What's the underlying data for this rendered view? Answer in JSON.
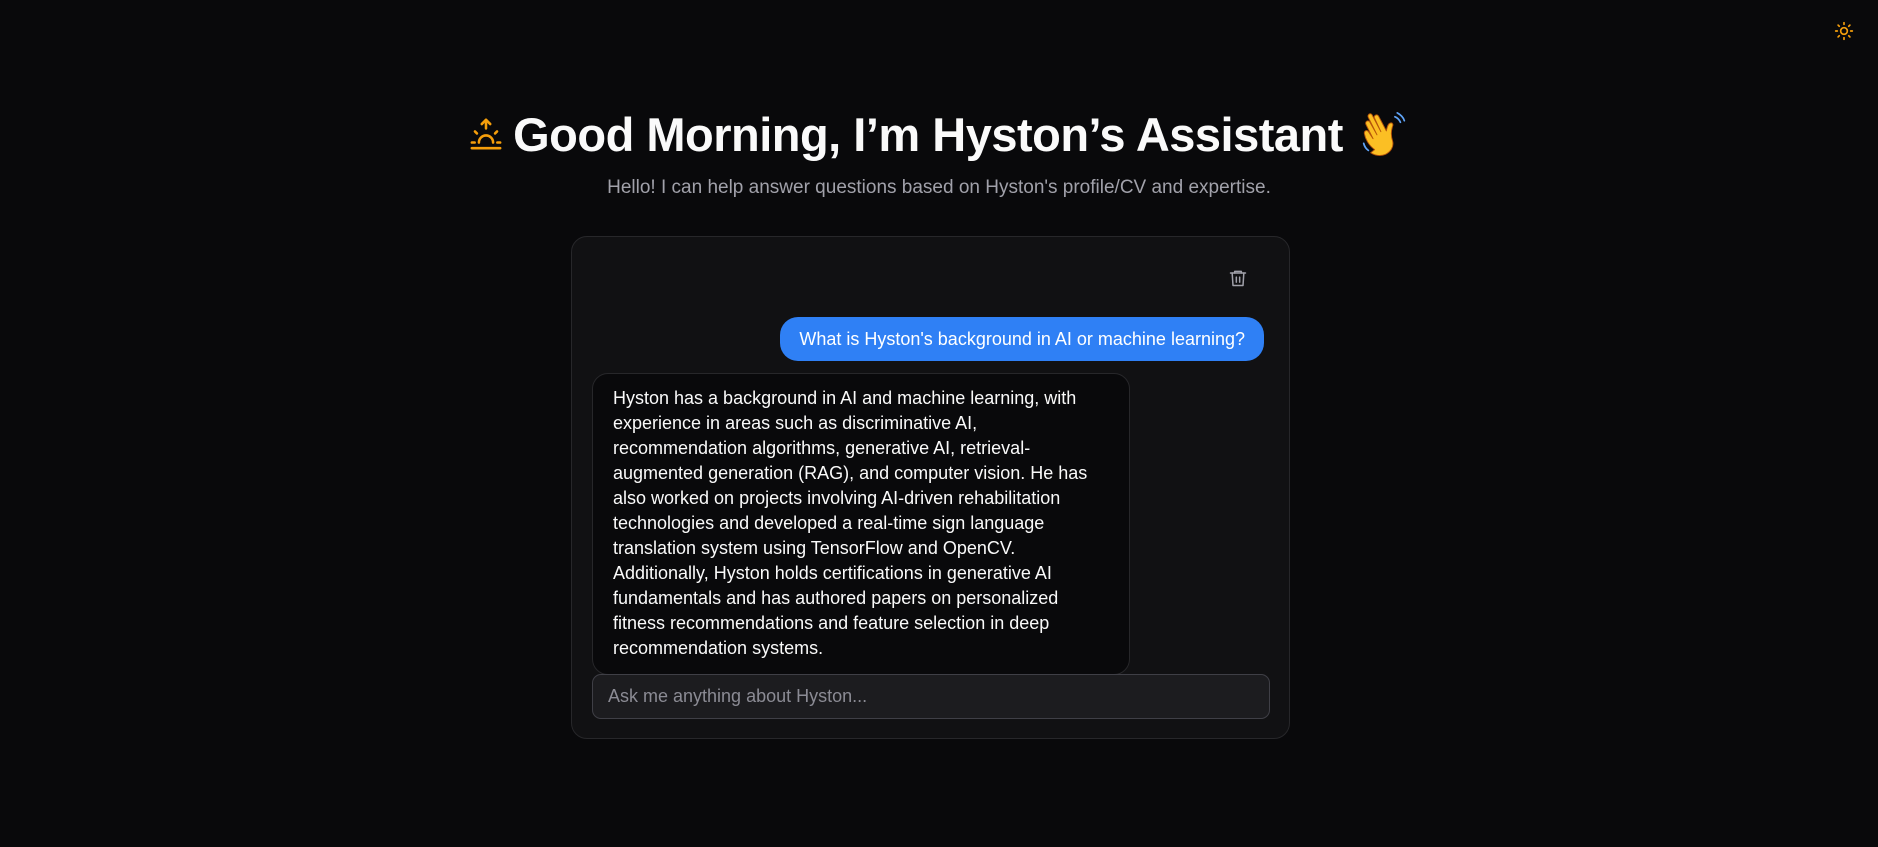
{
  "header": {
    "theme_toggle_icon": "sun-icon",
    "theme_icon_color": "#f59e0b"
  },
  "hero": {
    "greeting_icon": "sunrise-icon",
    "title": "Good Morning, I’m Hyston’s Assistant",
    "title_emoji_icon": "waving-hand-icon",
    "subtitle": "Hello! I can help answer questions based on Hyston's profile/CV and expertise."
  },
  "chat": {
    "clear_icon": "trash-icon",
    "messages": [
      {
        "role": "user",
        "text": "What is Hyston's background in AI or machine learning?"
      },
      {
        "role": "assistant",
        "text": "Hyston has a background in AI and machine learning, with experience in areas such as discriminative AI, recommendation algorithms, generative AI, retrieval-augmented generation (RAG), and computer vision. He has also worked on projects involving AI-driven rehabilitation technologies and developed a real-time sign language translation system using TensorFlow and OpenCV. Additionally, Hyston holds certifications in generative AI fundamentals and has authored papers on personalized fitness recommendations and feature selection in deep recommendation systems."
      }
    ],
    "input": {
      "placeholder": "Ask me anything about Hyston...",
      "value": ""
    }
  },
  "colors": {
    "background": "#09090b",
    "card": "#111113",
    "user_bubble": "#2f80f5",
    "accent_orange": "#f59e0b"
  }
}
